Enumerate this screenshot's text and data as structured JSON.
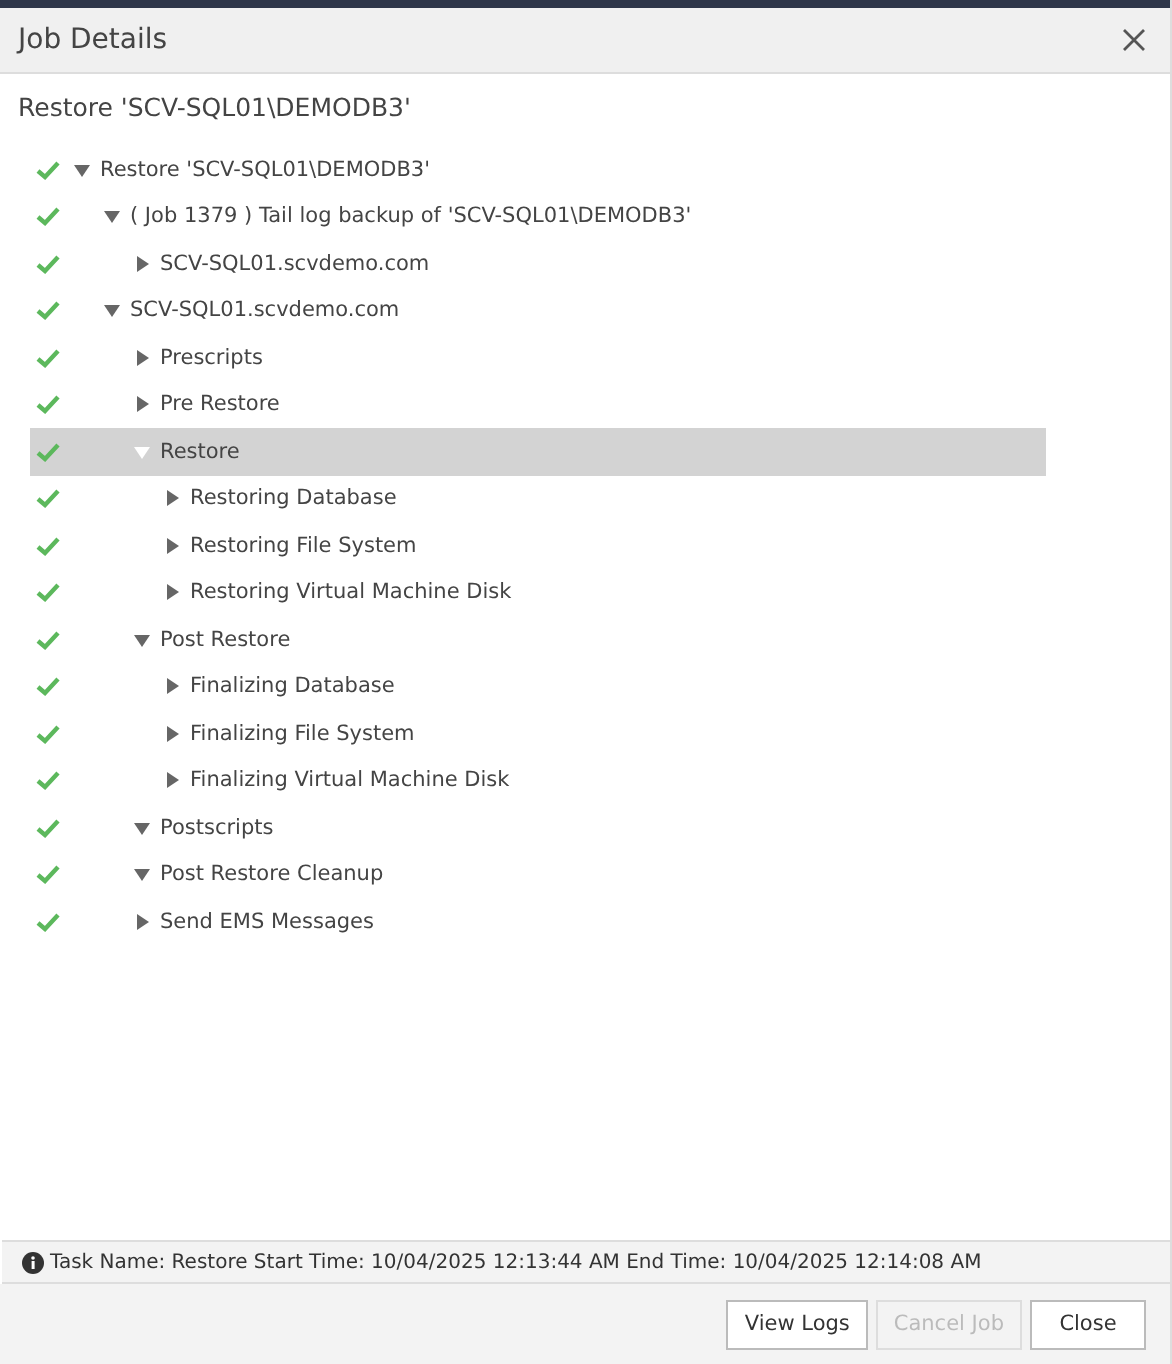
{
  "window": {
    "title": "Job Details"
  },
  "job_title": "Restore 'SCV-SQL01\\DEMODB3'",
  "tree": [
    {
      "label": "Restore 'SCV-SQL01\\DEMODB3'",
      "expanded": true,
      "selected": false,
      "children": [
        {
          "label": "( Job 1379 ) Tail log backup of 'SCV-SQL01\\DEMODB3'",
          "expanded": true,
          "selected": false,
          "children": [
            {
              "label": "SCV-SQL01.scvdemo.com",
              "expanded": false,
              "selected": false
            }
          ]
        },
        {
          "label": "SCV-SQL01.scvdemo.com",
          "expanded": true,
          "selected": false,
          "children": [
            {
              "label": "Prescripts",
              "expanded": false,
              "selected": false
            },
            {
              "label": "Pre Restore",
              "expanded": false,
              "selected": false
            },
            {
              "label": "Restore",
              "expanded": true,
              "selected": true,
              "children": [
                {
                  "label": "Restoring Database",
                  "expanded": false,
                  "selected": false
                },
                {
                  "label": "Restoring File System",
                  "expanded": false,
                  "selected": false
                },
                {
                  "label": "Restoring Virtual Machine Disk",
                  "expanded": false,
                  "selected": false
                }
              ]
            },
            {
              "label": "Post Restore",
              "expanded": true,
              "selected": false,
              "children": [
                {
                  "label": "Finalizing Database",
                  "expanded": false,
                  "selected": false
                },
                {
                  "label": "Finalizing File System",
                  "expanded": false,
                  "selected": false
                },
                {
                  "label": "Finalizing Virtual Machine Disk",
                  "expanded": false,
                  "selected": false
                }
              ]
            },
            {
              "label": "Postscripts",
              "expanded": true,
              "selected": false
            },
            {
              "label": "Post Restore Cleanup",
              "expanded": true,
              "selected": false
            },
            {
              "label": "Send EMS Messages",
              "expanded": false,
              "selected": false
            }
          ]
        }
      ]
    }
  ],
  "status_bar": {
    "text": "Task Name: Restore Start Time: 10/04/2025 12:13:44 AM End Time: 10/04/2025 12:14:08 AM"
  },
  "buttons": [
    {
      "label": "View Logs",
      "disabled": false
    },
    {
      "label": "Cancel Job",
      "disabled": true
    },
    {
      "label": "Close",
      "disabled": false
    }
  ]
}
